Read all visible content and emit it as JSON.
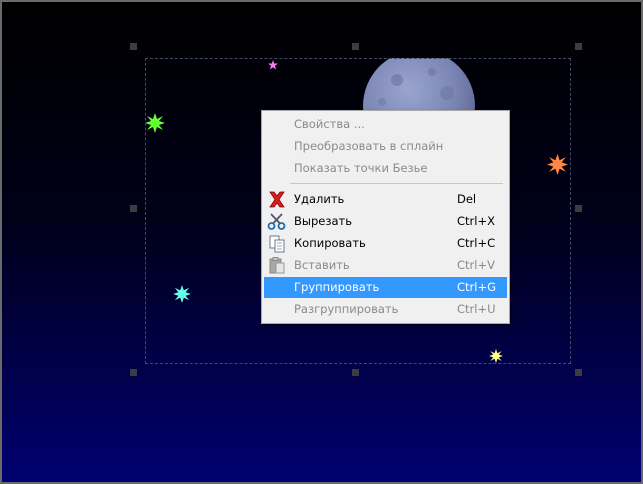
{
  "context_menu": {
    "items": [
      {
        "label": "Свойства ...",
        "shortcut": "",
        "icon": "",
        "disabled": true,
        "active": false
      },
      {
        "label": "Преобразовать в сплайн",
        "shortcut": "",
        "icon": "",
        "disabled": true,
        "active": false
      },
      {
        "label": "Показать точки Безье",
        "shortcut": "",
        "icon": "",
        "disabled": true,
        "active": false
      },
      {
        "label": "Удалить",
        "shortcut": "Del",
        "icon": "delete-icon",
        "disabled": false,
        "active": false
      },
      {
        "label": "Вырезать",
        "shortcut": "Ctrl+X",
        "icon": "cut-icon",
        "disabled": false,
        "active": false
      },
      {
        "label": "Копировать",
        "shortcut": "Ctrl+C",
        "icon": "copy-icon",
        "disabled": false,
        "active": false
      },
      {
        "label": "Вставить",
        "shortcut": "Ctrl+V",
        "icon": "paste-icon",
        "disabled": true,
        "active": false
      },
      {
        "label": "Группировать",
        "shortcut": "Ctrl+G",
        "icon": "",
        "disabled": false,
        "active": true
      },
      {
        "label": "Разгруппировать",
        "shortcut": "Ctrl+U",
        "icon": "",
        "disabled": true,
        "active": false
      }
    ]
  },
  "colors": {
    "highlight": "#3399ff",
    "star_green": "#66ff33",
    "star_orange": "#ff8844",
    "star_cyan": "#66ffee",
    "star_yellow": "#ffff88",
    "star_pink": "#ff77ff",
    "moon": "#7c86b4"
  }
}
